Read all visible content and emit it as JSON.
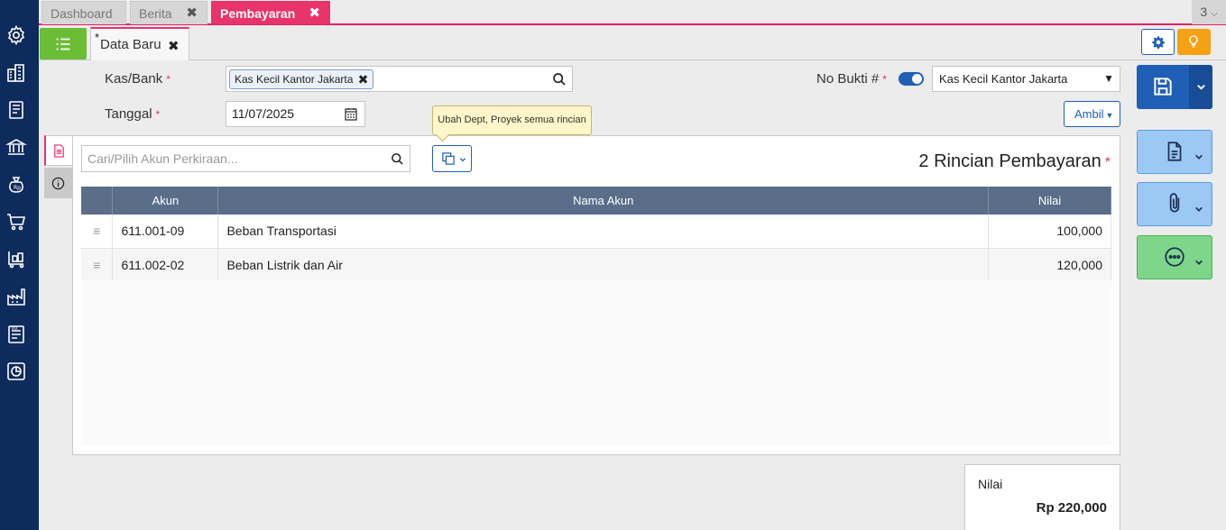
{
  "tabs": [
    {
      "label": "Dashboard"
    },
    {
      "label": "Berita"
    },
    {
      "label": "Pembayaran"
    }
  ],
  "tab_count": "3",
  "doc_tab": {
    "modified_marker": "*",
    "label": "Data Baru"
  },
  "form": {
    "kas_bank_label": "Kas/Bank",
    "kas_bank_value": "Kas Kecil Kantor Jakarta",
    "tanggal_label": "Tanggal",
    "tanggal_value": "11/07/2025",
    "no_bukti_label": "No Bukti #",
    "no_bukti_select": "Kas Kecil Kantor Jakarta",
    "ambil_label": "Ambil",
    "required_marker": "*"
  },
  "tooltip": "Ubah Dept, Proyek semua rincian",
  "detail": {
    "search_placeholder": "Cari/Pilih Akun Perkiraan...",
    "title": "2 Rincian Pembayaran",
    "columns": {
      "akun": "Akun",
      "nama": "Nama Akun",
      "nilai": "Nilai"
    },
    "rows": [
      {
        "akun": "611.001-09",
        "nama": "Beban Transportasi",
        "nilai": "100,000"
      },
      {
        "akun": "611.002-02",
        "nama": "Beban Listrik dan Air",
        "nilai": "120,000"
      }
    ]
  },
  "total": {
    "label": "Nilai",
    "value": "Rp 220,000"
  },
  "colors": {
    "nav": "#0d2b5c",
    "accent": "#e8336b",
    "primary": "#1f5fb6",
    "green": "#6bbd36",
    "orange": "#f5a114"
  },
  "icons": [
    "gear-icon",
    "building-icon",
    "book-icon",
    "bank-icon",
    "money-bag-icon",
    "cart-icon",
    "trolley-icon",
    "factory-icon",
    "tax-report-icon",
    "chart-report-icon"
  ]
}
